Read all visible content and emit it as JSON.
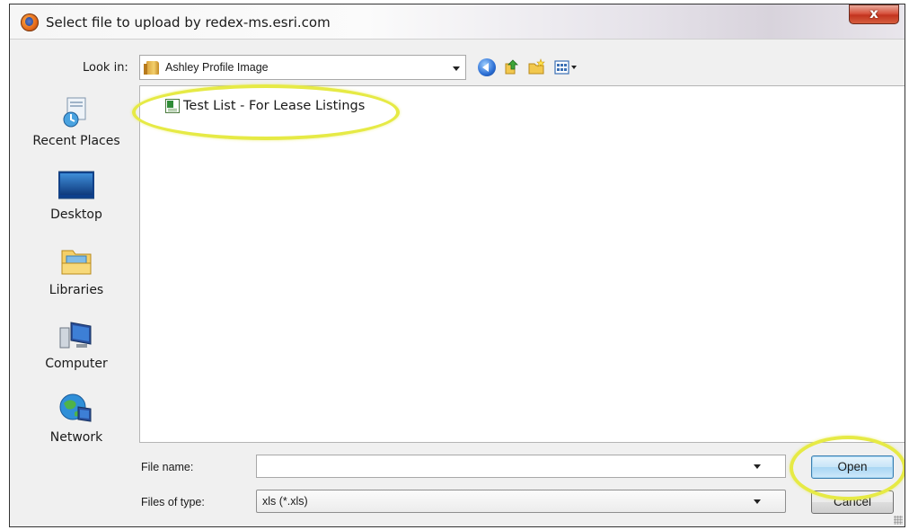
{
  "window": {
    "title": "Select file to upload by redex-ms.esri.com",
    "close_label": "x"
  },
  "toolbar": {
    "look_in_label": "Look in:",
    "look_in_value": "Ashley Profile Image"
  },
  "sidebar": {
    "items": [
      {
        "label": "Recent Places",
        "icon": "recent-places-icon"
      },
      {
        "label": "Desktop",
        "icon": "desktop-icon"
      },
      {
        "label": "Libraries",
        "icon": "libraries-icon"
      },
      {
        "label": "Computer",
        "icon": "computer-icon"
      },
      {
        "label": "Network",
        "icon": "network-icon"
      }
    ]
  },
  "files": [
    {
      "name": "Test List - For Lease Listings",
      "icon": "excel-file-icon"
    }
  ],
  "form": {
    "file_name_label": "File name:",
    "file_name_value": "",
    "files_of_type_label": "Files of type:",
    "files_of_type_value": "xls (*.xls)",
    "open_label": "Open",
    "cancel_label": "Cancel"
  },
  "colors": {
    "highlight": "#e6ea45",
    "open_button": "#c8e5f8",
    "close_button": "#c2341f"
  }
}
